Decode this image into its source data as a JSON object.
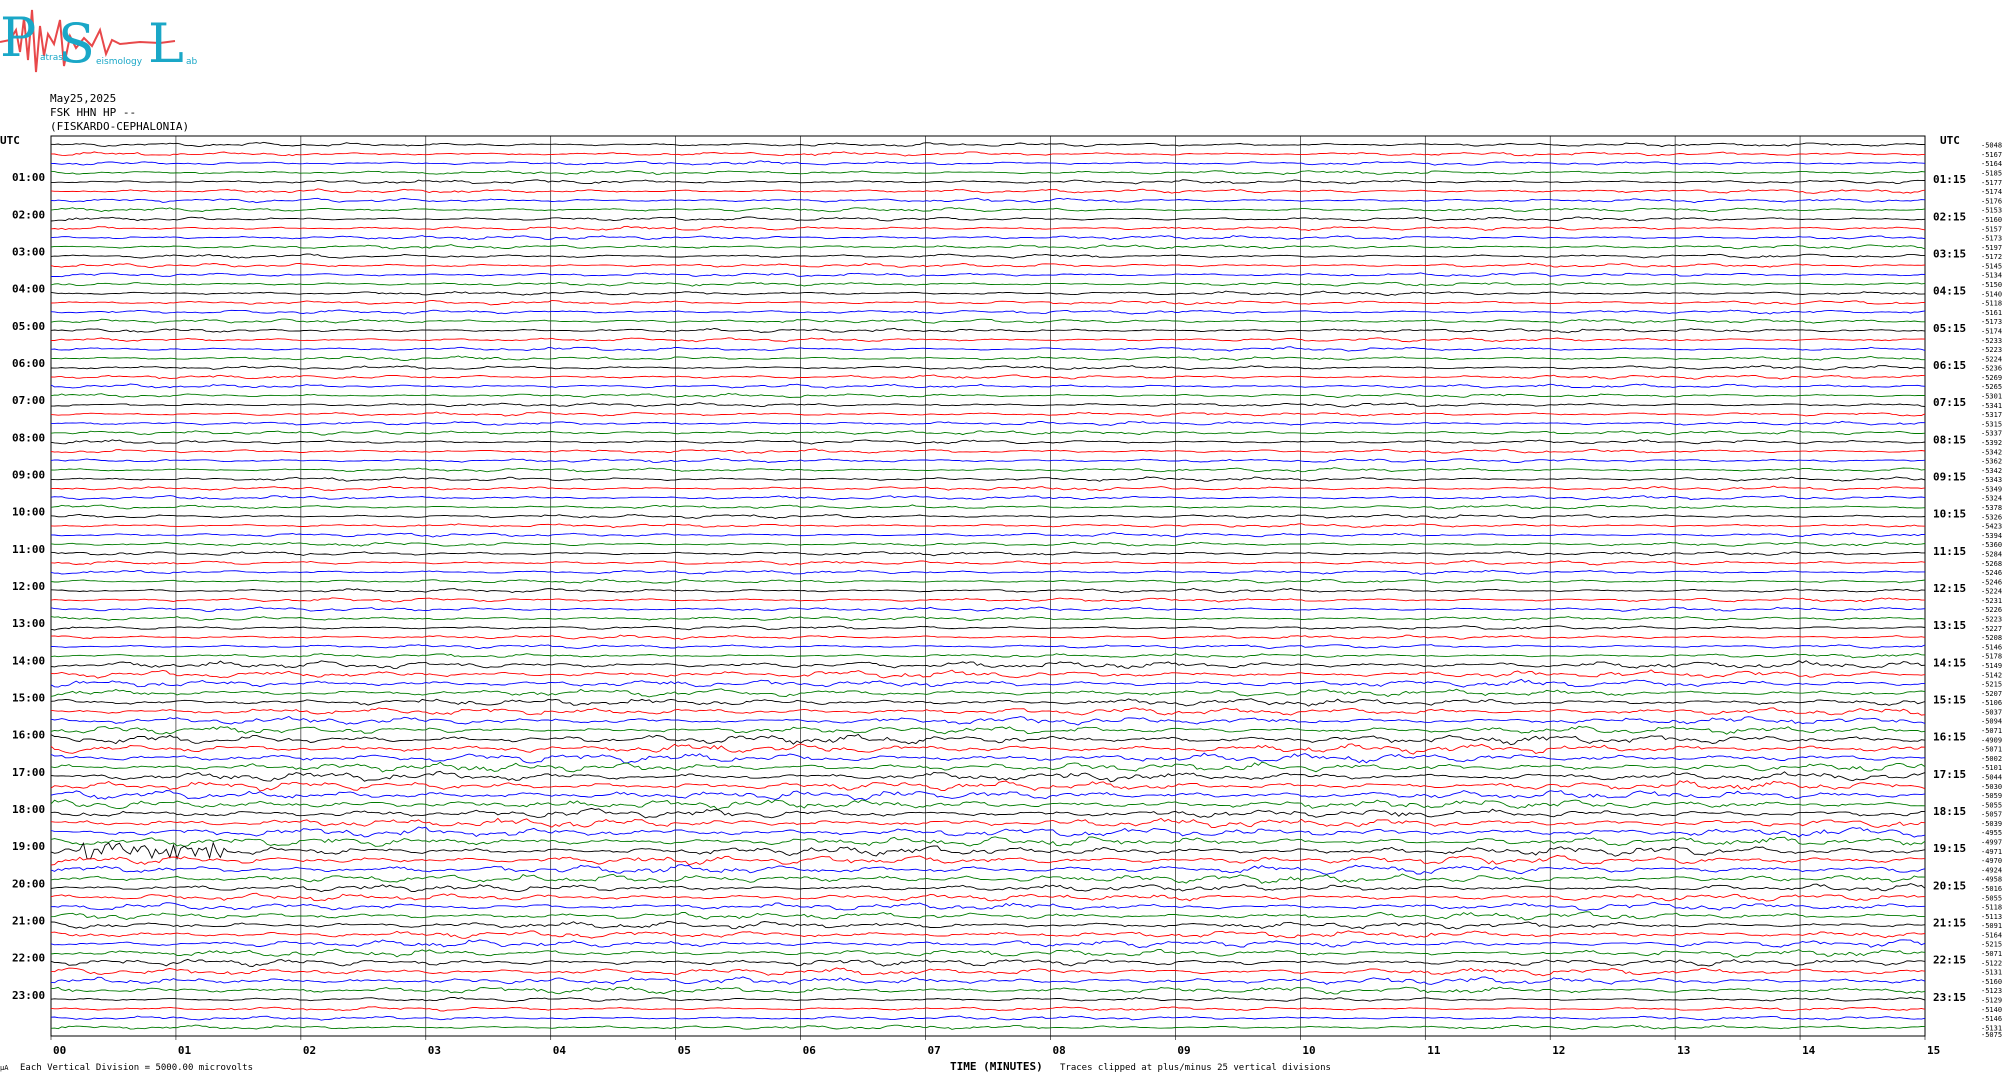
{
  "logo": {
    "letters": [
      "P",
      "S",
      "L"
    ],
    "small_words": [
      "atras",
      "eismology",
      "ab"
    ],
    "colors": {
      "letters": "#1aa7c7",
      "trace": "#e8484a"
    }
  },
  "header": {
    "date": "May25,2025",
    "station": "FSK HHN HP --",
    "location": "(FISKARDO-CEPHALONIA)"
  },
  "footer": {
    "scale_note": "Each Vertical Division = 5000.00 microvolts",
    "clip_note": "Traces clipped at plus/minus 25 vertical divisions",
    "corner_mark": "µA"
  },
  "chart_data": {
    "type": "line",
    "xlabel": "TIME (MINUTES)",
    "x_ticks": [
      "00",
      "01",
      "02",
      "03",
      "04",
      "05",
      "06",
      "07",
      "08",
      "09",
      "10",
      "11",
      "12",
      "13",
      "14",
      "15"
    ],
    "xlim": [
      0,
      15
    ],
    "left_axis_title": "UTC",
    "right_axis_title": "UTC",
    "left_hour_labels": [
      "01:00",
      "02:00",
      "03:00",
      "04:00",
      "05:00",
      "06:00",
      "07:00",
      "08:00",
      "09:00",
      "10:00",
      "11:00",
      "12:00",
      "13:00",
      "14:00",
      "15:00",
      "16:00",
      "17:00",
      "18:00",
      "19:00",
      "20:00",
      "21:00",
      "22:00",
      "23:00"
    ],
    "right_hour_labels": [
      "01:15",
      "02:15",
      "03:15",
      "04:15",
      "05:15",
      "06:15",
      "07:15",
      "08:15",
      "09:15",
      "10:15",
      "11:15",
      "12:15",
      "13:15",
      "14:15",
      "15:15",
      "16:15",
      "17:15",
      "18:15",
      "19:15",
      "20:15",
      "21:15",
      "22:15",
      "23:15"
    ],
    "trace_colors": [
      "#000000",
      "#ff0000",
      "#0000ff",
      "#007a00"
    ],
    "trace_count": 96,
    "minutes_per_trace": 15,
    "trace_offsets": [
      "-5048",
      "-5167",
      "-5164",
      "-5185",
      "-5177",
      "-5174",
      "-5176",
      "-5153",
      "-5160",
      "-5157",
      "-5173",
      "-5197",
      "-5172",
      "-5145",
      "-5134",
      "-5150",
      "-5140",
      "-5118",
      "-5161",
      "-5173",
      "-5174",
      "-5233",
      "-5223",
      "-5224",
      "-5236",
      "-5269",
      "-5265",
      "-5301",
      "-5341",
      "-5317",
      "-5315",
      "-5337",
      "-5392",
      "-5342",
      "-5362",
      "-5342",
      "-5343",
      "-5349",
      "-5324",
      "-5378",
      "-5326",
      "-5423",
      "-5394",
      "-5360",
      "-5284",
      "-5268",
      "-5246",
      "-5246",
      "-5224",
      "-5231",
      "-5226",
      "-5223",
      "-5227",
      "-5208",
      "-5146",
      "-5178",
      "-5149",
      "-5142",
      "-5215",
      "-5207",
      "-5106",
      "-5037",
      "-5094",
      "-5071",
      "-4909",
      "-5071",
      "-5002",
      "-5101",
      "-5044",
      "-5030",
      "-5059",
      "-5055",
      "-5057",
      "-5039",
      "-4955",
      "-4997",
      "-4971",
      "-4970",
      "-4924",
      "-4958",
      "-5016",
      "-5055",
      "-5118",
      "-5113",
      "-5091",
      "-5164",
      "-5215",
      "-5071",
      "-5122",
      "-5131",
      "-5160",
      "-5123",
      "-5129",
      "-5140",
      "-5146",
      "-5131"
    ],
    "last_trace_offset": "-5075",
    "notable_event": {
      "hour": "19:00",
      "minute_range": [
        0.25,
        1.4
      ]
    }
  }
}
